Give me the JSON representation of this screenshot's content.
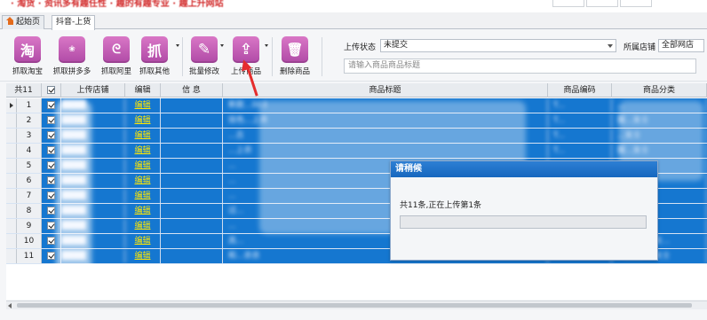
{
  "tabs": [
    {
      "label": "起始页",
      "icon": "home-icon"
    },
    {
      "label": "抖音-上货"
    }
  ],
  "toolbar": {
    "buttons": [
      {
        "label": "抓取淘宝",
        "glyph": "淘",
        "icon": "taobao-icon"
      },
      {
        "label": "抓取拼多多",
        "glyph": "❀",
        "icon": "pinduoduo-icon"
      },
      {
        "label": "抓取阿里",
        "glyph": "ᘓ",
        "icon": "alibaba-icon"
      },
      {
        "label": "抓取其他",
        "glyph": "抓",
        "icon": "grab-icon"
      },
      {
        "label": "批量修改",
        "glyph": "✎",
        "icon": "pencil-icon"
      },
      {
        "label": "上传商品",
        "glyph": "⇪",
        "icon": "upload-icon"
      },
      {
        "label": "删除商品",
        "glyph": "🗑",
        "icon": "trash-icon"
      }
    ],
    "upload_status_label": "上传状态",
    "upload_status_value": "未提交",
    "store_label": "所属店铺",
    "store_value": "全部网店",
    "search_placeholder": "请输入商品商品标题"
  },
  "grid": {
    "columns": {
      "count_label": "共11",
      "store": "上传店铺",
      "edit": "编辑",
      "info": "信 息",
      "title": "商品标题",
      "code": "商品编码",
      "category": "商品分类"
    },
    "rows": [
      {
        "num": "1",
        "edit": "编辑",
        "title": "新款...003",
        "code": "T...",
        "category": "..."
      },
      {
        "num": "2",
        "edit": "编辑",
        "title": "挂色...上衣",
        "code": "T...",
        "category": "服...女士"
      },
      {
        "num": "3",
        "edit": "编辑",
        "title": "...古",
        "code": "T...",
        "category": "...女士"
      },
      {
        "num": "4",
        "edit": "编辑",
        "title": "...上衣",
        "code": "T...",
        "category": "服...女士"
      },
      {
        "num": "5",
        "edit": "编辑",
        "title": "...",
        "code": "",
        "category": "..."
      },
      {
        "num": "6",
        "edit": "编辑",
        "title": "...",
        "code": "",
        "category": "..."
      },
      {
        "num": "7",
        "edit": "编辑",
        "title": "...",
        "code": "",
        "category": "..."
      },
      {
        "num": "8",
        "edit": "编辑",
        "title": "过...",
        "code": "",
        "category": "..."
      },
      {
        "num": "9",
        "edit": "编辑",
        "title": "...",
        "code": "",
        "category": "..."
      },
      {
        "num": "10",
        "edit": "编辑",
        "title": "高...",
        "code": "",
        "category": "...女装>>女..."
      },
      {
        "num": "11",
        "edit": "编辑",
        "title": "和...衣衣",
        "code": "",
        "category": "...女装>>女士"
      }
    ]
  },
  "modal": {
    "title": "请稍候",
    "message": "共11条,正在上传第1条",
    "progress": 0
  },
  "colors": {
    "selection": "#1577d0",
    "edit_link": "#ffe600",
    "arrow": "#e52d2d",
    "toolbar_icon": "#c05bb5"
  }
}
